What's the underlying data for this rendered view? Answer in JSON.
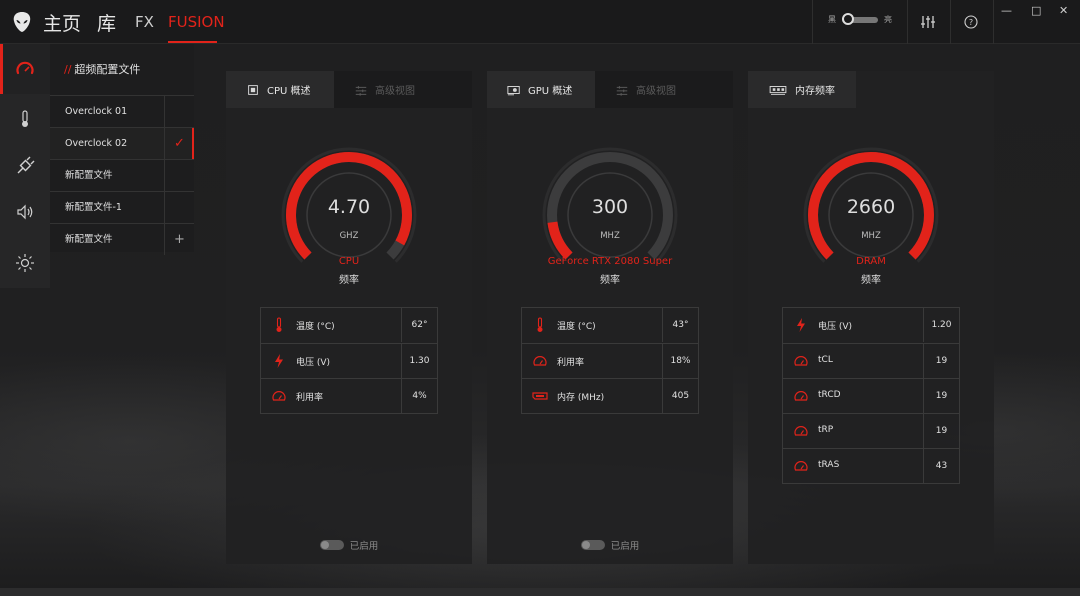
{
  "nav": {
    "home": "主页",
    "library": "库",
    "fx": "FX",
    "fusion": "FUSION"
  },
  "theme": {
    "dark": "黑",
    "light": "亮"
  },
  "icons": {
    "logo": "alien-head-icon",
    "equalizer": "sliders-icon",
    "help": "help-icon",
    "minimize": "minimize-icon",
    "maximize": "maximize-icon",
    "close": "close-icon"
  },
  "window_controls": {
    "minimize": "—",
    "maximize": "□",
    "close": "✕"
  },
  "rail": [
    "speedometer-icon",
    "thermometer-icon",
    "power-plug-icon",
    "speaker-icon",
    "brightness-icon"
  ],
  "profiles": {
    "header_prefix": "//",
    "header": "超频配置文件",
    "items": [
      {
        "label": "Overclock 01",
        "marker": ""
      },
      {
        "label": "Overclock 02",
        "marker": "✓"
      },
      {
        "label": "新配置文件",
        "marker": ""
      },
      {
        "label": "新配置文件-1",
        "marker": ""
      },
      {
        "label": "新配置文件",
        "marker": "+"
      }
    ]
  },
  "colors": {
    "accent": "#e2231a",
    "track": "#3c3c3d",
    "panel": "#212122"
  },
  "cards": [
    {
      "tabs": [
        {
          "label": "CPU 概述",
          "icon": "cpu-chip-icon"
        },
        {
          "label": "高级视图",
          "icon": "sliders-icon"
        }
      ],
      "gauge": {
        "value": "4.70",
        "unit": "GHZ",
        "fill": 0.94
      },
      "device": "CPU",
      "sub": "频率",
      "stats": [
        {
          "icon": "thermometer-icon",
          "label": "温度 (°C)",
          "value": "62°"
        },
        {
          "icon": "lightning-icon",
          "label": "电压 (V)",
          "value": "1.30"
        },
        {
          "icon": "speedometer-icon",
          "label": "利用率",
          "value": "4%"
        }
      ],
      "enabled": "已启用"
    },
    {
      "tabs": [
        {
          "label": "GPU 概述",
          "icon": "gpu-card-icon"
        },
        {
          "label": "高级视图",
          "icon": "sliders-icon"
        }
      ],
      "gauge": {
        "value": "300",
        "unit": "MHZ",
        "fill": 0.14
      },
      "device": "GeForce RTX 2080 Super",
      "sub": "频率",
      "stats": [
        {
          "icon": "thermometer-icon",
          "label": "温度 (°C)",
          "value": "43°"
        },
        {
          "icon": "speedometer-icon",
          "label": "利用率",
          "value": "18%"
        },
        {
          "icon": "memory-icon",
          "label": "内存 (MHz)",
          "value": "405"
        }
      ],
      "enabled": "已启用"
    },
    {
      "tabs": [
        {
          "label": "内存频率",
          "icon": "memory-stick-icon"
        }
      ],
      "gauge": {
        "value": "2660",
        "unit": "MHZ",
        "fill": 1.0
      },
      "device": "DRAM",
      "sub": "频率",
      "stats": [
        {
          "icon": "lightning-icon",
          "label": "电压 (V)",
          "value": "1.20"
        },
        {
          "icon": "speedometer-icon",
          "label": "tCL",
          "value": "19"
        },
        {
          "icon": "speedometer-icon",
          "label": "tRCD",
          "value": "19"
        },
        {
          "icon": "speedometer-icon",
          "label": "tRP",
          "value": "19"
        },
        {
          "icon": "speedometer-icon",
          "label": "tRAS",
          "value": "43"
        }
      ],
      "enabled": ""
    }
  ]
}
